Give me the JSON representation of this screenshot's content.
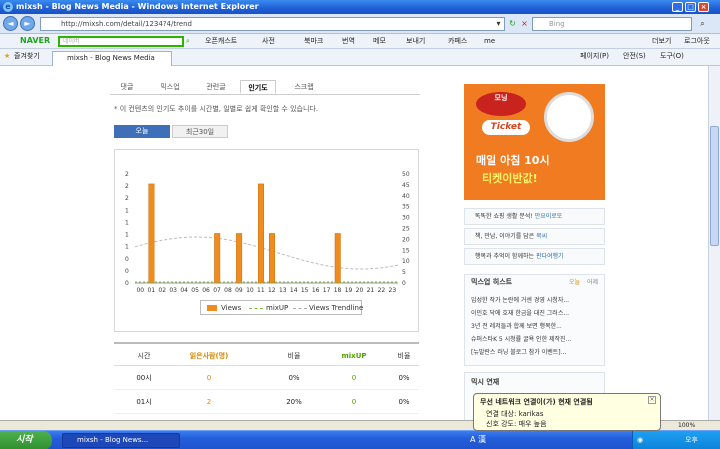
{
  "window": {
    "title": "mixsh - Blog News Media - Windows Internet Explorer"
  },
  "nav": {
    "url": "http://mixsh.com/detail/1234?4/trend",
    "search_placeholder": "Bing"
  },
  "naver": {
    "logo": "NAVER",
    "search_placeholder": "네이버",
    "items": [
      "오픈캐스트",
      "사전",
      "북마크",
      "번역",
      "메모",
      "보내기",
      "카페스",
      "me"
    ]
  },
  "favbar": {
    "favorites": "즐겨찾기",
    "tab": "mixsh - Blog News Media",
    "tools": [
      "페이지(P)",
      "안전(S)",
      "도구(O)"
    ]
  },
  "menu_right": [
    "더보기",
    "로그아웃"
  ],
  "tabs": [
    "댓글",
    "믹스업",
    "관련글",
    "인기도",
    "스크랩"
  ],
  "active_tab": 3,
  "description": "* 이 컨텐츠의 인기도 추이를 시간별, 일별로 쉽게 확인할 수 있습니다.",
  "period": {
    "today": "오늘",
    "recent": "최근30일"
  },
  "chart_data": {
    "type": "bar",
    "categories": [
      "00",
      "01",
      "02",
      "03",
      "04",
      "05",
      "06",
      "07",
      "08",
      "09",
      "10",
      "11",
      "12",
      "13",
      "14",
      "15",
      "16",
      "17",
      "18",
      "19",
      "20",
      "21",
      "22",
      "23"
    ],
    "series": [
      {
        "name": "Views",
        "values": [
          0,
          2,
          0,
          0,
          0,
          0,
          0,
          1,
          0,
          1,
          0,
          2,
          1,
          0,
          0,
          0,
          0,
          0,
          1,
          0,
          0,
          0,
          0,
          0
        ]
      },
      {
        "name": "mixUP",
        "values": [
          0,
          0,
          0,
          0,
          0,
          0,
          0,
          0,
          0,
          0,
          0,
          0,
          0,
          0,
          0,
          0,
          0,
          0,
          0,
          0,
          0,
          0,
          0,
          0
        ]
      },
      {
        "name": "Views Trendline",
        "values": []
      }
    ],
    "y_left_ticks": [
      "0",
      "0",
      "0",
      "1",
      "1",
      "1",
      "1",
      "2",
      "2",
      "2"
    ],
    "y_right_ticks": [
      "0",
      "5",
      "10",
      "15",
      "20",
      "25",
      "30",
      "35",
      "40",
      "45",
      "50"
    ],
    "xlabel": "",
    "ylabel": "",
    "title": "",
    "grid": false,
    "legend": "bottom"
  },
  "table": {
    "headers": [
      "시간",
      "읽은사람(명)",
      "비율",
      "mixUP",
      "비율"
    ],
    "rows": [
      [
        "00시",
        "0",
        "0%",
        "0",
        "0%"
      ],
      [
        "01시",
        "2",
        "20%",
        "0",
        "0%"
      ]
    ]
  },
  "ad": {
    "brand": "모닝",
    "ticket": "Ticket",
    "line1": "매일 아침 10시",
    "line2": "티켓이반값!"
  },
  "links": [
    {
      "text": "똑똑한 쇼핑 생활 분석!",
      "accent": "만요이로또"
    },
    {
      "text": "책, 만남, 이야기를 담은",
      "accent": "북씨"
    },
    {
      "text": "행복과 추억이 함께하는",
      "accent": "판다여행기"
    }
  ],
  "hot": {
    "title": "믹스업 히스트",
    "tabs": [
      "오늘",
      "어제"
    ],
    "items": [
      "임성한 작가 논란에 거센 경영 시청자...",
      "이민호 닥에 호재 한금을 대진 그러스...",
      "3년 전 레저들과 합께 보면 행복한...",
      "슈퍼스타K 5 시청률 굴욕 인한 제작진...",
      "[뉴발란스 러닝 블로그 참가 이벤트]..."
    ]
  },
  "mix": {
    "title": "믹시 연재"
  },
  "status": {
    "zoom": "100%"
  },
  "taskbar": {
    "start": "시작",
    "task": "mixsh - Blog News...",
    "time": "오후 11:03"
  },
  "balloon": {
    "title": "무선 네트워크 연결이(가) 현재 연결됨",
    "line1": "연결 대상: karikas",
    "line2": "신호 강도: 매우 높음"
  }
}
